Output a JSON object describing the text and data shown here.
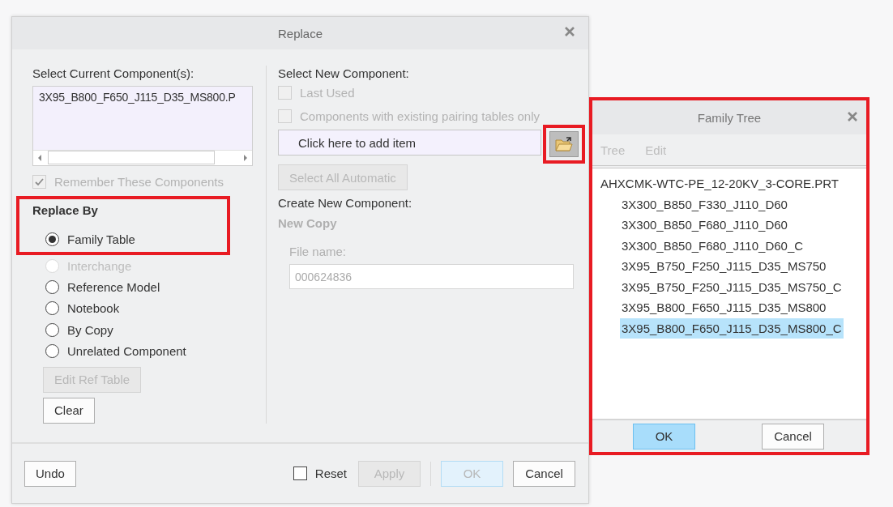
{
  "window": {
    "title": "Replace"
  },
  "current_components": {
    "label": "Select Current Component(s):",
    "items": [
      "3X95_B800_F650_J115_D35_MS800.P"
    ]
  },
  "remember": {
    "label": "Remember These Components",
    "checked": true,
    "disabled": true
  },
  "replace_by": {
    "title": "Replace By",
    "highlighted": true,
    "options": [
      {
        "label": "Family Table",
        "selected": true,
        "disabled": false
      },
      {
        "label": "Interchange",
        "selected": false,
        "disabled": true
      },
      {
        "label": "Reference Model",
        "selected": false,
        "disabled": false
      },
      {
        "label": "Notebook",
        "selected": false,
        "disabled": false
      },
      {
        "label": "By Copy",
        "selected": false,
        "disabled": false
      },
      {
        "label": "Unrelated Component",
        "selected": false,
        "disabled": false
      }
    ]
  },
  "edit_ref_table": {
    "label": "Edit Ref Table",
    "disabled": true
  },
  "clear": {
    "label": "Clear",
    "disabled": false
  },
  "new_component": {
    "label": "Select New Component:",
    "options": [
      {
        "label": "Last Used",
        "checked": false,
        "disabled": true
      },
      {
        "label": "Components with existing pairing tables only",
        "checked": false,
        "disabled": true
      }
    ],
    "item_field": {
      "placeholder": "Click here to add item"
    },
    "browse_button": {
      "highlighted": true
    },
    "select_all": {
      "label": "Select All Automatic",
      "disabled": true
    }
  },
  "create": {
    "label": "Create New Component:",
    "mode": {
      "label": "New Copy",
      "disabled": true
    },
    "file_name": {
      "label": "File name:",
      "value": "000624836",
      "disabled": true
    }
  },
  "footer": {
    "undo": {
      "label": "Undo",
      "disabled": false
    },
    "reset": {
      "label": "Reset",
      "checked": false,
      "disabled": false
    },
    "buttons": [
      {
        "label": "Apply",
        "disabled": true,
        "kind": "normal"
      },
      {
        "label": "OK",
        "disabled": true,
        "kind": "default"
      },
      {
        "label": "Cancel",
        "disabled": false,
        "kind": "normal"
      }
    ]
  },
  "family_tree": {
    "title": "Family Tree",
    "highlighted": true,
    "menu": [
      {
        "label": "Tree",
        "disabled": true
      },
      {
        "label": "Edit",
        "disabled": true
      }
    ],
    "tree": {
      "label": "AHXCMK-WTC-PE_12-20KV_3-CORE.PRT",
      "selected": false,
      "children": [
        {
          "label": "3X300_B850_F330_J110_D60",
          "selected": false
        },
        {
          "label": "3X300_B850_F680_J110_D60",
          "selected": false
        },
        {
          "label": "3X300_B850_F680_J110_D60_C",
          "selected": false
        },
        {
          "label": "3X95_B750_F250_J115_D35_MS750",
          "selected": false
        },
        {
          "label": "3X95_B750_F250_J115_D35_MS750_C",
          "selected": false
        },
        {
          "label": "3X95_B800_F650_J115_D35_MS800",
          "selected": false
        },
        {
          "label": "3X95_B800_F650_J115_D35_MS800_C",
          "selected": true
        }
      ]
    },
    "buttons": [
      {
        "label": "OK",
        "disabled": false,
        "kind": "default"
      },
      {
        "label": "Cancel",
        "disabled": false,
        "kind": "normal"
      }
    ]
  }
}
